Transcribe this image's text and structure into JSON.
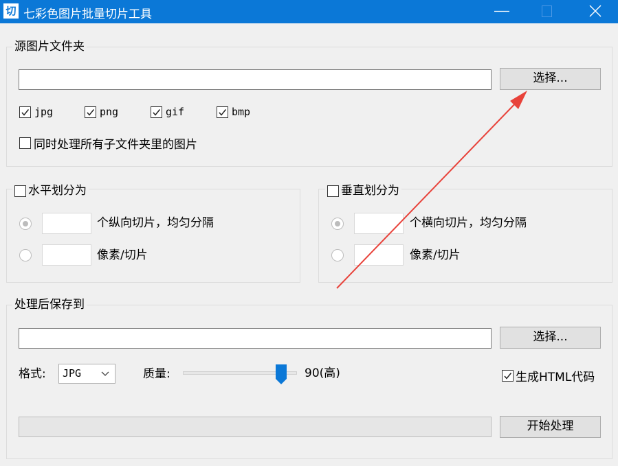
{
  "window": {
    "app_icon_glyph": "切",
    "title": "七彩色图片批量切片工具"
  },
  "source": {
    "group_title": "源图片文件夹",
    "folder_value": "",
    "choose_label": "选择...",
    "formats": [
      {
        "label": "jpg",
        "checked": true
      },
      {
        "label": "png",
        "checked": true
      },
      {
        "label": "gif",
        "checked": true
      },
      {
        "label": "bmp",
        "checked": true
      }
    ],
    "subfolders_label": "同时处理所有子文件夹里的图片",
    "subfolders_checked": false
  },
  "horizontal": {
    "group_title": "水平划分为",
    "enabled": false,
    "option1_value": "",
    "option1_label": "个纵向切片，均匀分隔",
    "option1_selected": true,
    "option2_value": "",
    "option2_label": "像素/切片",
    "option2_selected": false
  },
  "vertical": {
    "group_title": "垂直划分为",
    "enabled": false,
    "option1_value": "",
    "option1_label": "个横向切片，均匀分隔",
    "option1_selected": true,
    "option2_value": "",
    "option2_label": "像素/切片",
    "option2_selected": false
  },
  "output": {
    "group_title": "处理后保存到",
    "folder_value": "",
    "choose_label": "选择...",
    "format_label": "格式:",
    "format_value": "JPG",
    "quality_label": "质量:",
    "quality_value": 90,
    "quality_text": "90(高)",
    "html_label": "生成HTML代码",
    "html_checked": true,
    "progress": 0,
    "start_label": "开始处理"
  },
  "colors": {
    "titlebar": "#0b78d7",
    "slider_thumb": "#0b78d7",
    "annotation_arrow": "#e8423a"
  },
  "icons": [
    "app-icon",
    "minimize-icon",
    "maximize-icon",
    "close-icon",
    "checkbox-check-icon",
    "chevron-down-icon"
  ]
}
